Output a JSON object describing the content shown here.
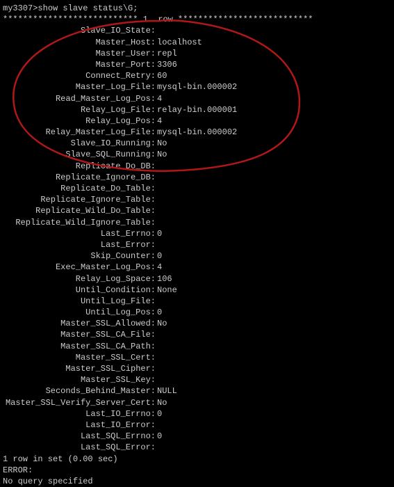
{
  "prompt": "my3307>",
  "command": "show slave status\\G;",
  "row_sep_left": "*************************** ",
  "row_label": "1. row",
  "row_sep_right": " ***************************",
  "fields": [
    {
      "k": "Slave_IO_State",
      "v": ""
    },
    {
      "k": "Master_Host",
      "v": "localhost"
    },
    {
      "k": "Master_User",
      "v": "repl"
    },
    {
      "k": "Master_Port",
      "v": "3306"
    },
    {
      "k": "Connect_Retry",
      "v": "60"
    },
    {
      "k": "Master_Log_File",
      "v": "mysql-bin.000002"
    },
    {
      "k": "Read_Master_Log_Pos",
      "v": "4"
    },
    {
      "k": "Relay_Log_File",
      "v": "relay-bin.000001"
    },
    {
      "k": "Relay_Log_Pos",
      "v": "4"
    },
    {
      "k": "Relay_Master_Log_File",
      "v": "mysql-bin.000002"
    },
    {
      "k": "Slave_IO_Running",
      "v": "No"
    },
    {
      "k": "Slave_SQL_Running",
      "v": "No"
    },
    {
      "k": "Replicate_Do_DB",
      "v": ""
    },
    {
      "k": "Replicate_Ignore_DB",
      "v": ""
    },
    {
      "k": "Replicate_Do_Table",
      "v": ""
    },
    {
      "k": "Replicate_Ignore_Table",
      "v": ""
    },
    {
      "k": "Replicate_Wild_Do_Table",
      "v": ""
    },
    {
      "k": "Replicate_Wild_Ignore_Table",
      "v": ""
    },
    {
      "k": "Last_Errno",
      "v": "0"
    },
    {
      "k": "Last_Error",
      "v": ""
    },
    {
      "k": "Skip_Counter",
      "v": "0"
    },
    {
      "k": "Exec_Master_Log_Pos",
      "v": "4"
    },
    {
      "k": "Relay_Log_Space",
      "v": "106"
    },
    {
      "k": "Until_Condition",
      "v": "None"
    },
    {
      "k": "Until_Log_File",
      "v": ""
    },
    {
      "k": "Until_Log_Pos",
      "v": "0"
    },
    {
      "k": "Master_SSL_Allowed",
      "v": "No"
    },
    {
      "k": "Master_SSL_CA_File",
      "v": ""
    },
    {
      "k": "Master_SSL_CA_Path",
      "v": ""
    },
    {
      "k": "Master_SSL_Cert",
      "v": ""
    },
    {
      "k": "Master_SSL_Cipher",
      "v": ""
    },
    {
      "k": "Master_SSL_Key",
      "v": ""
    },
    {
      "k": "Seconds_Behind_Master",
      "v": "NULL"
    },
    {
      "k": "Master_SSL_Verify_Server_Cert",
      "v": "No"
    },
    {
      "k": "Last_IO_Errno",
      "v": "0"
    },
    {
      "k": "Last_IO_Error",
      "v": ""
    },
    {
      "k": "Last_SQL_Errno",
      "v": "0"
    },
    {
      "k": "Last_SQL_Error",
      "v": ""
    }
  ],
  "rowcount": "1 row in set (0.00 sec)",
  "blank": "",
  "err_label": "ERROR:",
  "err_msg": "No query specified"
}
